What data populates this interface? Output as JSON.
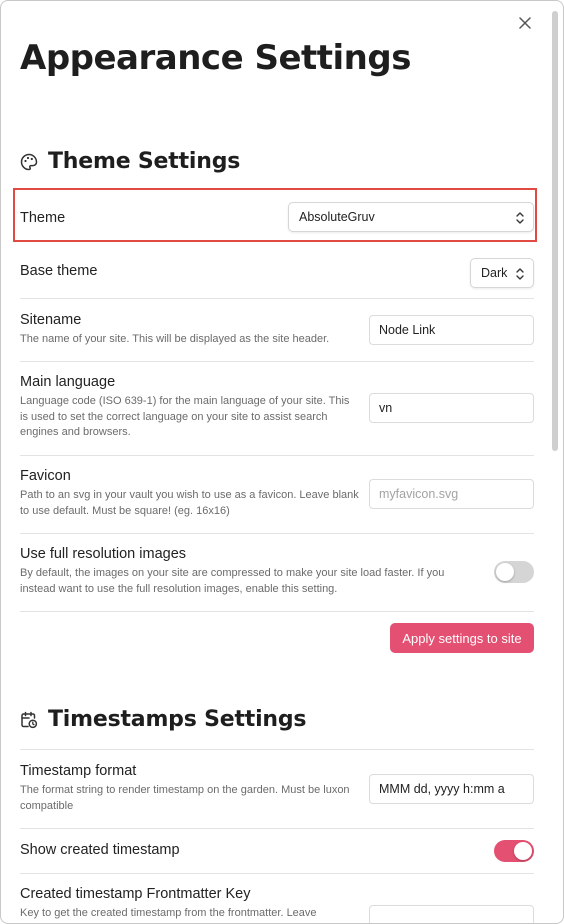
{
  "page_title": "Appearance Settings",
  "theme_section": {
    "title": "Theme Settings",
    "icon": "palette-icon",
    "theme": {
      "label": "Theme",
      "value": "AbsoluteGruv"
    },
    "base_theme": {
      "label": "Base theme",
      "value": "Dark"
    },
    "sitename": {
      "label": "Sitename",
      "description": "The name of your site. This will be displayed as the site header.",
      "value": "Node Link"
    },
    "main_language": {
      "label": "Main language",
      "description": "Language code (ISO 639-1) for the main language of your site. This is used to set the correct language on your site to assist search engines and browsers.",
      "value": "vn"
    },
    "favicon": {
      "label": "Favicon",
      "description": "Path to an svg in your vault you wish to use as a favicon. Leave blank to use default. Must be square! (eg. 16x16)",
      "placeholder": "myfavicon.svg"
    },
    "full_res": {
      "label": "Use full resolution images",
      "description": "By default, the images on your site are compressed to make your site load faster. If you instead want to use the full resolution images, enable this setting.",
      "enabled": false
    },
    "apply_label": "Apply settings to site"
  },
  "timestamps_section": {
    "title": "Timestamps Settings",
    "icon": "calendar-clock-icon",
    "format": {
      "label": "Timestamp format",
      "description": "The format string to render timestamp on the garden. Must be luxon compatible",
      "value": "MMM dd, yyyy h:mm a"
    },
    "show_created": {
      "label": "Show created timestamp",
      "enabled": true
    },
    "created_key": {
      "label": "Created timestamp Frontmatter Key",
      "description": "Key to get the created timestamp from the frontmatter. Leave"
    }
  },
  "colors": {
    "accent": "#e45072",
    "highlight_border": "#e04a43",
    "toggle_off": "#d5d5d5"
  }
}
